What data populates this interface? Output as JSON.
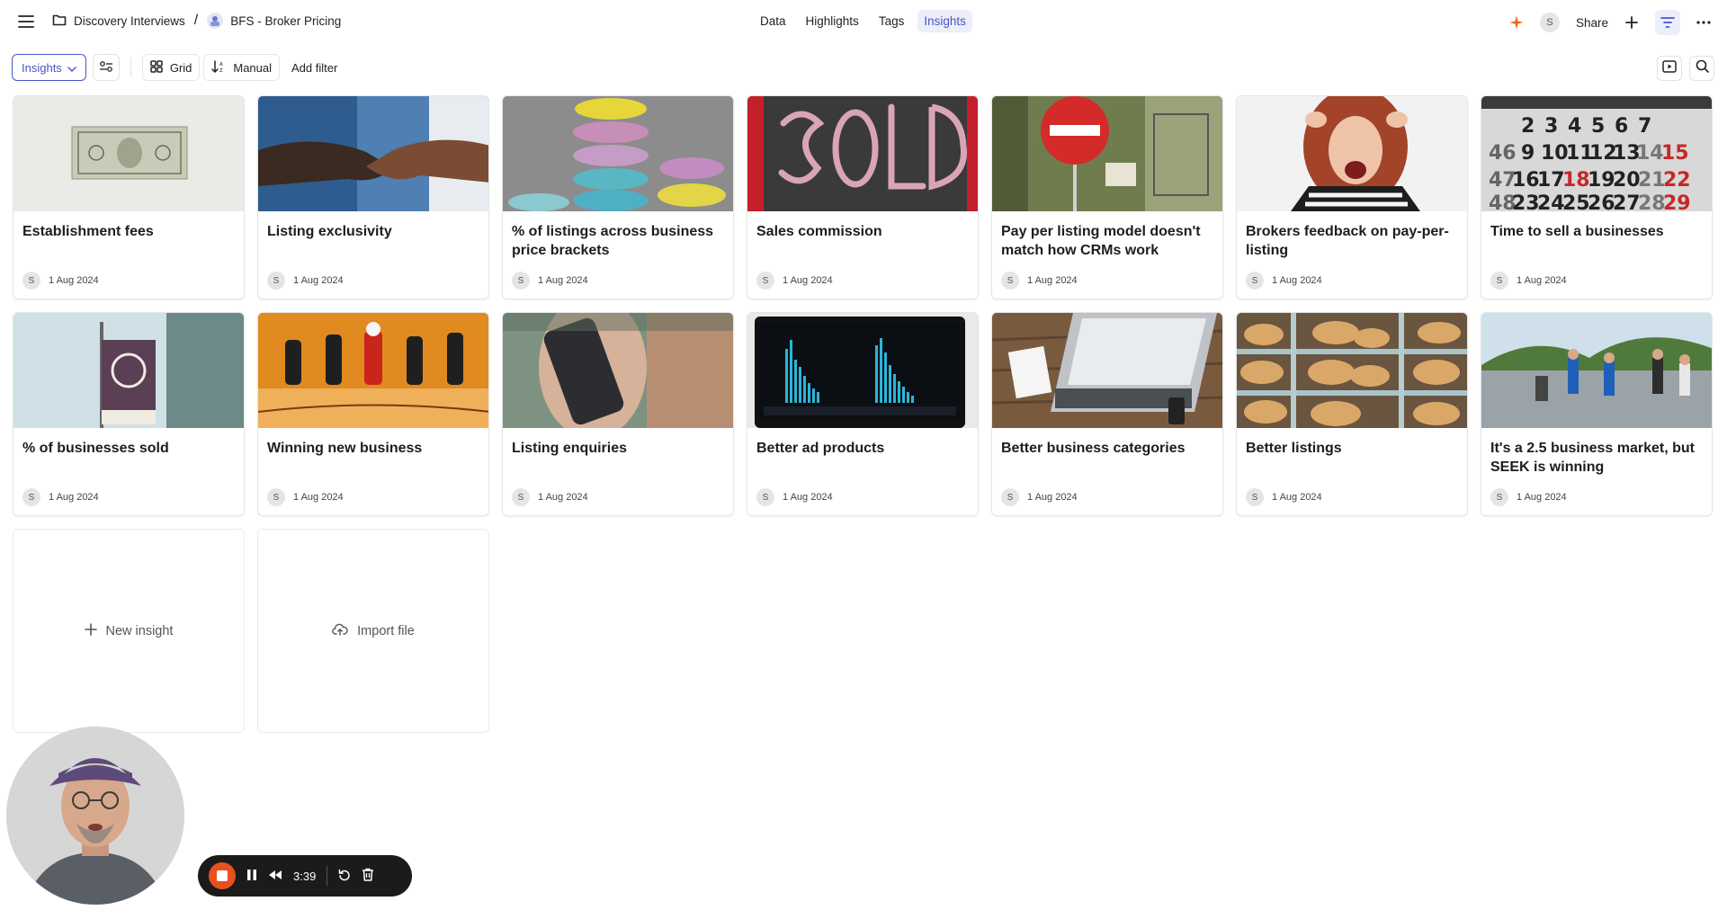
{
  "header": {
    "folder": "Discovery Interviews",
    "project": "BFS - Broker Pricing",
    "tabs": [
      {
        "label": "Data",
        "active": false
      },
      {
        "label": "Highlights",
        "active": false
      },
      {
        "label": "Tags",
        "active": false
      },
      {
        "label": "Insights",
        "active": true
      }
    ],
    "user_initial": "S",
    "share_label": "Share",
    "accent_color": "#4856c8",
    "sparkle_color": "#f26a1b"
  },
  "toolbar": {
    "view_select": "Insights",
    "grid_label": "Grid",
    "sort_label": "Manual",
    "add_filter_label": "Add filter"
  },
  "cards": [
    {
      "title": "Establishment fees",
      "author": "S",
      "date": "1 Aug 2024",
      "image": "dollar-bill"
    },
    {
      "title": "Listing exclusivity",
      "author": "S",
      "date": "1 Aug 2024",
      "image": "handshake"
    },
    {
      "title": "% of listings across business price brackets",
      "author": "S",
      "date": "1 Aug 2024",
      "image": "macarons"
    },
    {
      "title": "Sales commission",
      "author": "S",
      "date": "1 Aug 2024",
      "image": "sold-chalkboard"
    },
    {
      "title": "Pay per listing model doesn't match how CRMs work",
      "author": "S",
      "date": "1 Aug 2024",
      "image": "no-entry-sign"
    },
    {
      "title": "Brokers feedback on pay-per-listing",
      "author": "S",
      "date": "1 Aug 2024",
      "image": "frustrated-woman"
    },
    {
      "title": "Time to sell a businesses",
      "author": "S",
      "date": "1 Aug 2024",
      "image": "calendar"
    },
    {
      "title": "% of businesses sold",
      "author": "S",
      "date": "1 Aug 2024",
      "image": "sold-sign"
    },
    {
      "title": "Winning new business",
      "author": "S",
      "date": "1 Aug 2024",
      "image": "toy-figures"
    },
    {
      "title": "Listing enquiries",
      "author": "S",
      "date": "1 Aug 2024",
      "image": "phone-call"
    },
    {
      "title": "Better ad products",
      "author": "S",
      "date": "1 Aug 2024",
      "image": "analytics-laptop"
    },
    {
      "title": "Better business categories",
      "author": "S",
      "date": "1 Aug 2024",
      "image": "laptop-desk"
    },
    {
      "title": "Better listings",
      "author": "S",
      "date": "1 Aug 2024",
      "image": "pastries"
    },
    {
      "title": "It's a 2.5 business market, but SEEK is winning",
      "author": "S",
      "date": "1 Aug 2024",
      "image": "runners"
    }
  ],
  "actions": {
    "new_insight": "New insight",
    "import_file": "Import file"
  },
  "recorder": {
    "time": "3:39",
    "stop_color": "#e8501f"
  }
}
